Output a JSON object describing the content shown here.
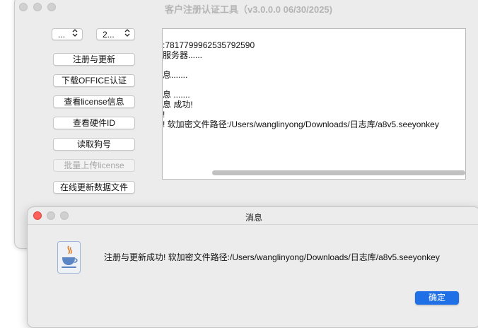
{
  "main_window": {
    "title": "客户注册认证工具（v3.0.0.0 06/30/2025)",
    "select_left": "...",
    "select_right": "2...",
    "chevron_glyph": "⌃⌄",
    "buttons": {
      "register_update": "注册与更新",
      "download_office": "下载OFFICE认证",
      "view_license": "查看license信息",
      "view_hardware": "查看硬件ID",
      "read_dongle": "读取狗号",
      "batch_upload": "批量上传license",
      "update_data": "在线更新数据文件"
    },
    "log_lines": [
      ":7817799962535792590",
      "服务器......",
      "",
      "息.......",
      "",
      "息 .......",
      "息 成功!",
      "!",
      "!  软加密文件路径:/Users/wanglinyong/Downloads/日志库/a8v5.seeyonkey"
    ]
  },
  "dialog": {
    "title": "消息",
    "message": "注册与更新成功!  软加密文件路径:/Users/wanglinyong/Downloads/日志库/a8v5.seeyonkey",
    "ok_label": "确定",
    "icon": "java-cup-icon"
  },
  "colors": {
    "accent": "#1f6fe6",
    "close_red": "#fe5f57",
    "window_bg": "#ececec"
  }
}
